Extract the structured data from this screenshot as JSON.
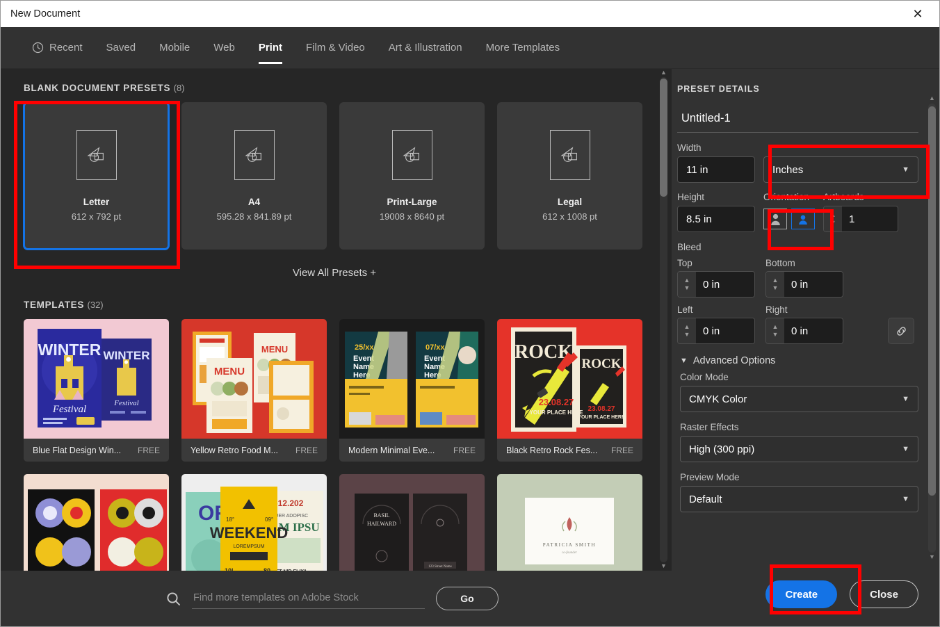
{
  "window": {
    "title": "New Document",
    "close_icon": "close-icon"
  },
  "tabs": [
    {
      "label": "Recent",
      "icon": "clock-icon",
      "active": false
    },
    {
      "label": "Saved",
      "active": false
    },
    {
      "label": "Mobile",
      "active": false
    },
    {
      "label": "Web",
      "active": false
    },
    {
      "label": "Print",
      "active": true
    },
    {
      "label": "Film & Video",
      "active": false
    },
    {
      "label": "Art & Illustration",
      "active": false
    },
    {
      "label": "More Templates",
      "active": false
    }
  ],
  "presets_section": {
    "heading": "BLANK DOCUMENT PRESETS",
    "count": "(8)",
    "view_all_label": "View All Presets +",
    "items": [
      {
        "name": "Letter",
        "dims": "612 x 792 pt",
        "selected": true
      },
      {
        "name": "A4",
        "dims": "595.28 x 841.89 pt",
        "selected": false
      },
      {
        "name": "Print-Large",
        "dims": "19008 x 8640 pt",
        "selected": false
      },
      {
        "name": "Legal",
        "dims": "612 x 1008 pt",
        "selected": false
      }
    ]
  },
  "templates_section": {
    "heading": "TEMPLATES",
    "count": "(32)",
    "items": [
      {
        "title": "Blue Flat Design Win...",
        "price": "FREE",
        "art": "winter"
      },
      {
        "title": "Yellow Retro Food M...",
        "price": "FREE",
        "art": "food"
      },
      {
        "title": "Modern Minimal Eve...",
        "price": "FREE",
        "art": "event"
      },
      {
        "title": "Black Retro Rock Fes...",
        "price": "FREE",
        "art": "rock"
      },
      {
        "title": "",
        "price": "",
        "art": "spiral"
      },
      {
        "title": "",
        "price": "",
        "art": "weekend"
      },
      {
        "title": "",
        "price": "",
        "art": "basil"
      },
      {
        "title": "",
        "price": "",
        "art": "patricia"
      }
    ]
  },
  "stock_search": {
    "placeholder": "Find more templates on Adobe Stock",
    "value": "",
    "go_label": "Go",
    "icon": "search-icon"
  },
  "preset_details": {
    "heading": "PRESET DETAILS",
    "document_name": "Untitled-1",
    "width": {
      "label": "Width",
      "value": "11 in"
    },
    "units": {
      "value": "Inches",
      "icon": "chevron-down-icon"
    },
    "height": {
      "label": "Height",
      "value": "8.5 in"
    },
    "orientation": {
      "label": "Orientation",
      "portrait_label": "portrait-orientation",
      "landscape_label": "landscape-orientation",
      "selected": "landscape"
    },
    "artboards": {
      "label": "Artboards",
      "value": "1"
    },
    "bleed": {
      "label": "Bleed",
      "top": {
        "label": "Top",
        "value": "0 in"
      },
      "bottom": {
        "label": "Bottom",
        "value": "0 in"
      },
      "left": {
        "label": "Left",
        "value": "0 in"
      },
      "right": {
        "label": "Right",
        "value": "0 in"
      },
      "link_icon": "link-icon"
    },
    "advanced": {
      "toggle_label": "Advanced Options",
      "color_mode": {
        "label": "Color Mode",
        "value": "CMYK Color"
      },
      "raster_effects": {
        "label": "Raster Effects",
        "value": "High (300 ppi)"
      },
      "preview_mode": {
        "label": "Preview Mode",
        "value": "Default"
      }
    }
  },
  "footer": {
    "create_label": "Create",
    "close_label": "Close"
  },
  "colors": {
    "accent_blue": "#1473e6",
    "highlight_red": "#ff0000",
    "panel_bg": "#323232",
    "content_bg": "#262626",
    "card_bg": "#3a3a3a"
  }
}
